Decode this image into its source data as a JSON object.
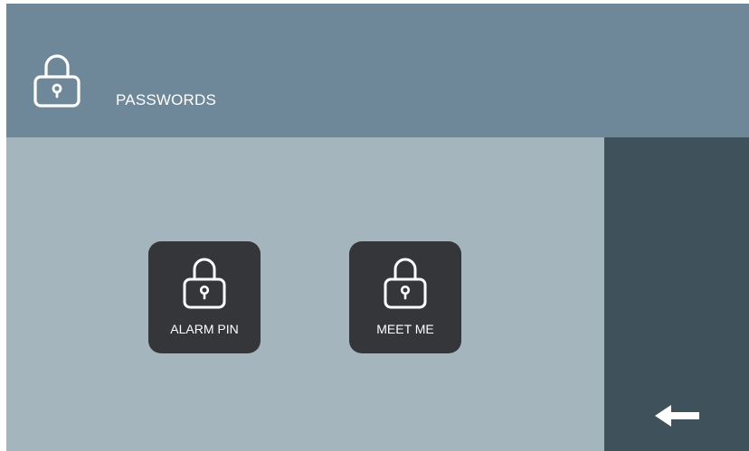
{
  "header": {
    "title": "PASSWORDS",
    "icon": "lock-icon"
  },
  "tiles": [
    {
      "label": "ALARM PIN",
      "icon": "lock-icon"
    },
    {
      "label": "MEET ME",
      "icon": "lock-icon"
    }
  ],
  "sidebar": {
    "back_icon": "arrow-left-icon"
  },
  "colors": {
    "header_bg": "#6e8799",
    "main_bg": "#a5b5be",
    "sidebar_bg": "#3f515b",
    "tile_bg": "#35363a",
    "foreground": "#ffffff"
  }
}
